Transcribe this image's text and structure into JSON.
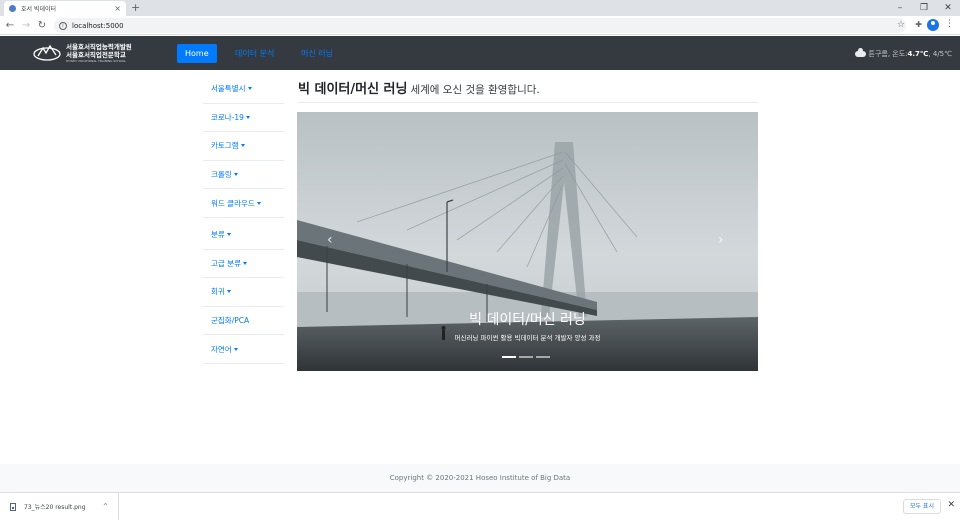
{
  "browser": {
    "tab_title": "호서 빅데이터",
    "tab_close": "×",
    "new_tab": "+",
    "url": "localhost:5000",
    "controls": {
      "minimize": "–",
      "maximize": "❐",
      "close": "✕"
    }
  },
  "navbar": {
    "logo_line1": "서울호서직업능력개발원",
    "logo_line2": "서울호서직업전문학교",
    "logo_line3": "HOSEO VOCATIONAL TRAINING SCHOOL",
    "items": [
      {
        "label": "Home",
        "active": true
      },
      {
        "label": "데이터 분석",
        "active": false
      },
      {
        "label": "머신 러닝",
        "active": false
      }
    ],
    "weather": {
      "desc": "튼구름, 온도: ",
      "temp": "4.7℃",
      "range": ", 4/5℃"
    }
  },
  "sidebar": {
    "items": [
      {
        "label": "서울특별시",
        "dropdown": true
      },
      {
        "label": "코로나-19",
        "dropdown": true
      },
      {
        "label": "카토그램",
        "dropdown": true
      },
      {
        "label": "크롤링",
        "dropdown": true
      },
      {
        "label": "워드 클라우드",
        "dropdown": true
      },
      {
        "label": "분류",
        "dropdown": true
      },
      {
        "label": "고급 분류",
        "dropdown": true
      },
      {
        "label": "회귀",
        "dropdown": true
      },
      {
        "label": "군집화/PCA",
        "dropdown": false
      },
      {
        "label": "자연어",
        "dropdown": true
      }
    ]
  },
  "main": {
    "heading_bold": "빅 데이터/머신 러닝",
    "heading_rest": "세계에 오신 것을 환영합니다.",
    "carousel": {
      "caption_title": "빅 데이터/머신 러닝",
      "caption_sub": "머신러닝 파이썬 활용 빅데이터 분석 개발자 양성 과정",
      "prev": "‹",
      "next": "›",
      "slides": 3,
      "active_slide": 1
    }
  },
  "footer": {
    "copyright": "Copyright © 2020-2021 Hoseo Institute of Big Data"
  },
  "downloads": {
    "filename": "73_뉴스20 result.png",
    "show_all": "모두 표시",
    "close": "✕"
  }
}
